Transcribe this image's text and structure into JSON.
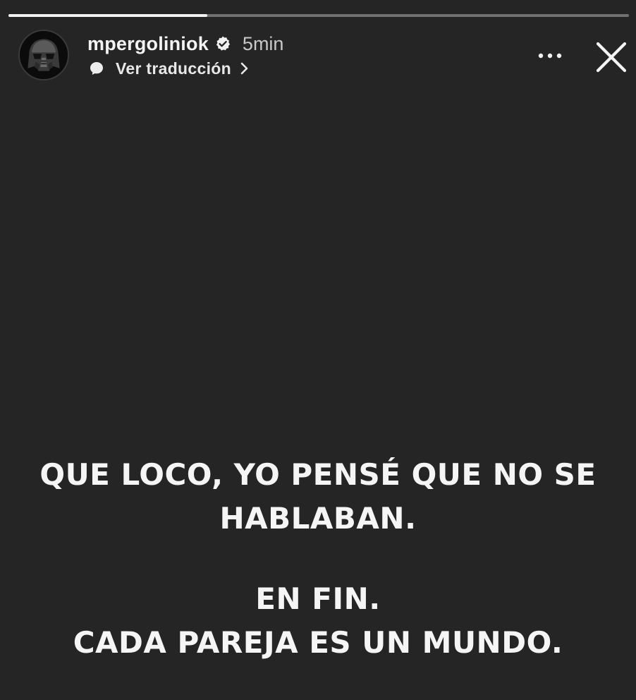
{
  "story": {
    "progress_fraction": 0.32,
    "user": {
      "username": "mpergoliniok",
      "time_ago": "5min",
      "verified": true
    },
    "translate": {
      "label": "Ver traducción",
      "icon": "speech-bubble-icon"
    },
    "controls": {
      "more_icon": "more-options-icon",
      "close_icon": "close-icon"
    },
    "text_lines": [
      "QUE LOCO, YO PENSÉ QUE NO SE",
      "HABLABAN.",
      "EN FIN.",
      "CADA PAREJA ES UN MUNDO."
    ],
    "colors": {
      "background": "#252525",
      "text": "#f5f5f5",
      "progress_fill": "#f2f2f2"
    }
  }
}
